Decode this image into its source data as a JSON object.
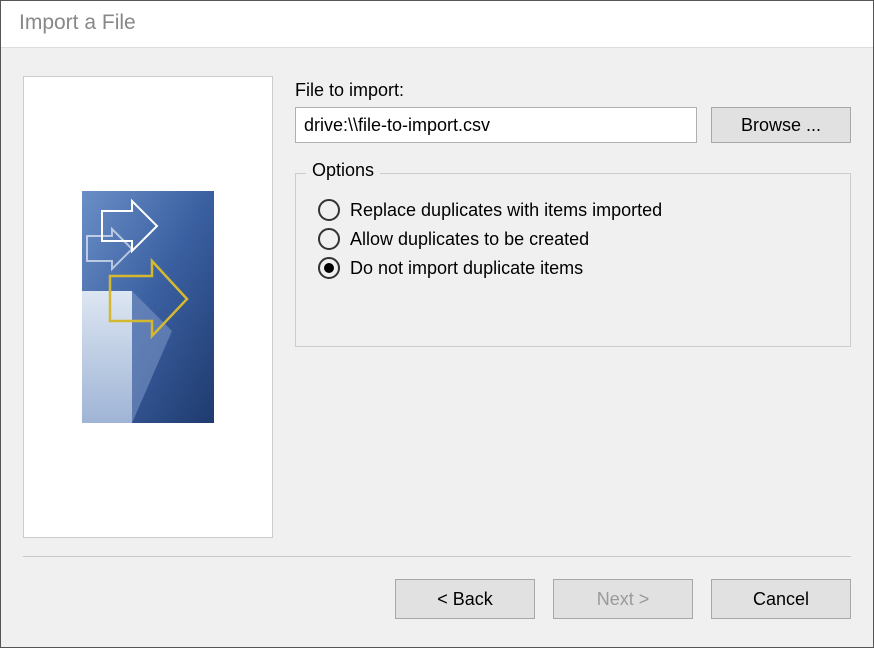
{
  "title": "Import a File",
  "file_section": {
    "label": "File to import:",
    "value": "drive:\\\\file-to-import.csv",
    "browse_label": "Browse ..."
  },
  "options": {
    "legend": "Options",
    "selected_index": 2,
    "items": [
      {
        "label": "Replace duplicates with items imported"
      },
      {
        "label": "Allow duplicates to be created"
      },
      {
        "label": "Do not import duplicate items"
      }
    ]
  },
  "buttons": {
    "back": "< Back",
    "next": "Next >",
    "cancel": "Cancel",
    "next_enabled": false
  }
}
